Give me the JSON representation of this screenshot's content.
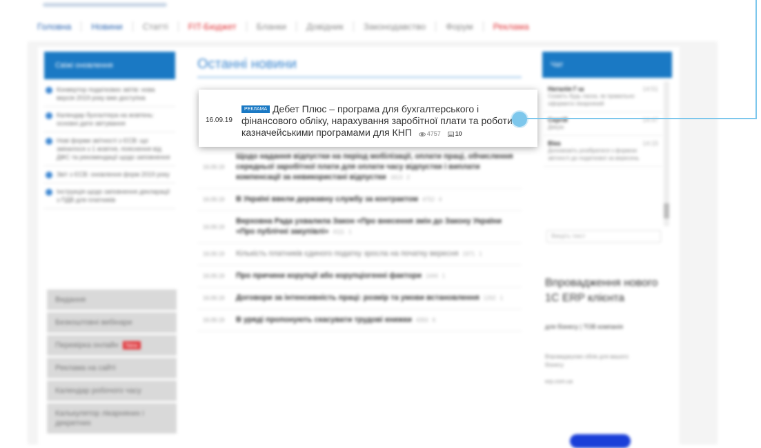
{
  "nav": {
    "items": [
      "Головна",
      "Новини",
      "Статті",
      "FIT-Бюджет",
      "Бланки",
      "Довідник",
      "Законодавство",
      "Форум",
      "Реклама"
    ]
  },
  "left": {
    "header": "Свіжі оновлення",
    "news": [
      "Конвертор податкових звітів: нова версія 2019 року вже доступна",
      "Календар бухгалтера на жовтень: основні дати звітування",
      "Нові форми звітності з ЄСВ: що змінилося з 1 жовтня, пояснення від ДФС та рекомендації щодо заповнення",
      "Звіт з ЄСВ: оновлення форм 2019 року",
      "Інструкція щодо заповнення декларації з ПДВ для платників"
    ],
    "menu": [
      "Видання",
      "Безкоштовні вебінари",
      "Перевірка онлайн",
      "Реклама на сайті",
      "Календар робочого часу",
      "Калькулятор лікарняних і декретних"
    ],
    "new_badge": "New"
  },
  "center": {
    "title": "Останні новини",
    "news": [
      {
        "date": "16.09.19",
        "text": "Щодо надання відпустки на період мобілізації, оплати праці, обчислення середньої заробітної плати для оплати часу відпустки і виплати компенсації за невикористані відпустки",
        "views": "1613",
        "comments": "2"
      },
      {
        "date": "16.09.19",
        "text": "В Україні ввели державну службу за контрактом",
        "views": "4752",
        "comments": "4"
      },
      {
        "date": "16.09.19",
        "text": "Верховна Рада ухвалила Закон «Про внесення змін до Закону України «Про публічні закупівлі»",
        "views": "4111",
        "comments": "1"
      },
      {
        "date": "16.09.19",
        "text": "Кількість платників єдиного податку зросла на початку вересня",
        "views": "1971",
        "comments": "1"
      },
      {
        "date": "16.09.19",
        "text": "Про причини корупції або корупціогенні фактори",
        "views": "1444",
        "comments": "1"
      },
      {
        "date": "16.09.19",
        "text": "Договори за інтенсивність праці: розмір та умови встановлення",
        "views": "1202",
        "comments": "1"
      },
      {
        "date": "16.09.19",
        "text": "В уряді пропонують скасувати трудові книжки",
        "views": "4350",
        "comments": "6"
      }
    ]
  },
  "popup": {
    "date": "16.09.19",
    "badge": "РЕКЛАМА",
    "title": "Дебет Плюс – програма для бухгалтерського і фінансового обліку, нарахування заробітної плати та роботи з казначейськими програмами для КНП",
    "views": "4757",
    "comments": "10"
  },
  "right": {
    "header": "Чат",
    "feed": [
      {
        "user": "Наталія Г-ш",
        "time": "14:51",
        "text": "Скажіть будь ласка, як правильно оформити лікарняний"
      },
      {
        "user": "Сергій",
        "time": "14:47",
        "text": "Дякую"
      },
      {
        "user": "Віка",
        "time": "14:15",
        "text": "Допоможіть розібратися з формою звітності до податкової за вересень"
      }
    ],
    "input_placeholder": "Введіть текст",
    "ad": {
      "title": "Впровадження нового 1С ERP клієнта",
      "subtitle": "для бізнесу | ТОВ компанія",
      "text": "Впроваджуємо облік для вашого бізнесу",
      "site": "erp.com.ua"
    }
  }
}
